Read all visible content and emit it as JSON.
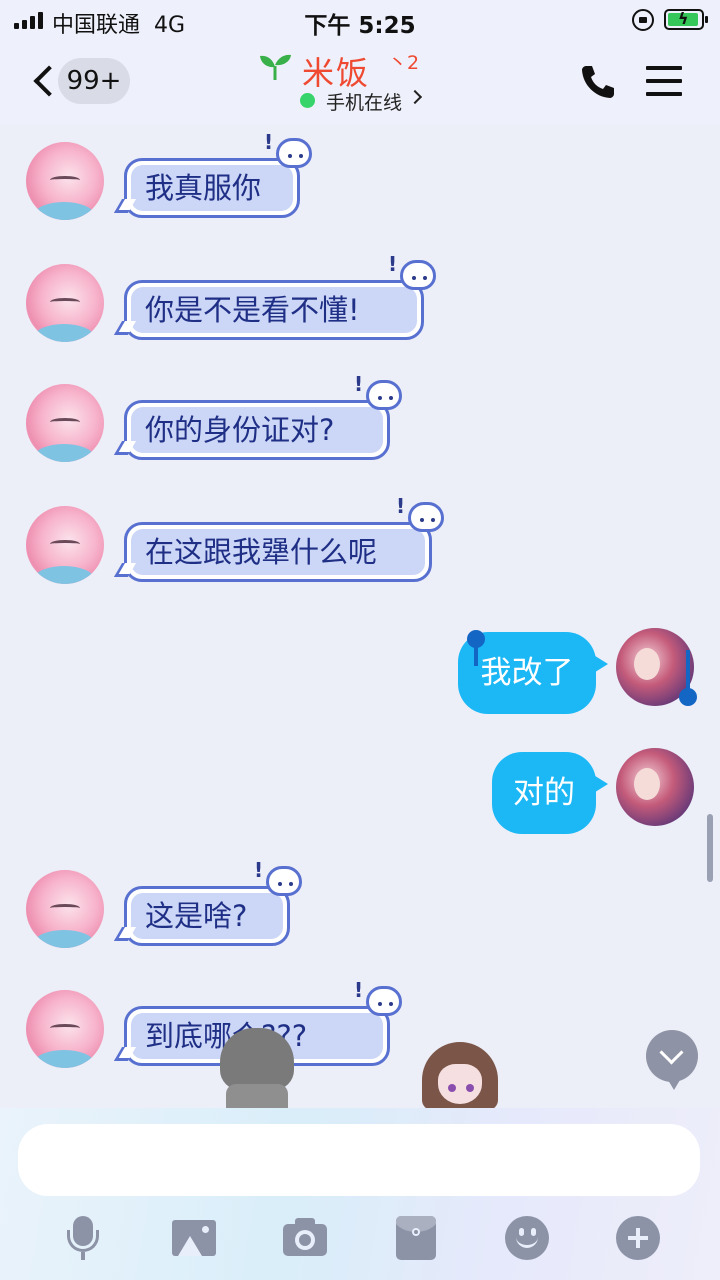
{
  "status_bar": {
    "carrier": "中国联通",
    "network": "4G",
    "time": "下午 5:25"
  },
  "header": {
    "unread_count": "99+",
    "contact_name": "米饭",
    "contact_level": "丶2",
    "online_status": "手机在线",
    "accent_color": "#ef4a31",
    "icons": [
      "back-icon",
      "sprout-icon",
      "phone-icon",
      "menu-icon"
    ]
  },
  "messages": [
    {
      "side": "in",
      "text": "我真服你"
    },
    {
      "side": "in",
      "text": "你是不是看不懂!"
    },
    {
      "side": "in",
      "text": "你的身份证对?"
    },
    {
      "side": "in",
      "text": "在这跟我犟什么呢"
    },
    {
      "side": "out",
      "text": "我改了",
      "selected": true
    },
    {
      "side": "out",
      "text": "对的"
    },
    {
      "side": "in",
      "text": "这是啥?"
    },
    {
      "side": "in",
      "text": "到底哪个???"
    }
  ],
  "composer": {
    "input_value": "",
    "tools": [
      "mic-icon",
      "image-icon",
      "camera-icon",
      "red-packet-icon",
      "emoji-icon",
      "plus-icon"
    ]
  },
  "colors": {
    "outgoing_bubble": "#1cb8f6",
    "incoming_bubble_border": "#5870d0",
    "incoming_text": "#1f2f86",
    "online_dot": "#36d46a"
  }
}
